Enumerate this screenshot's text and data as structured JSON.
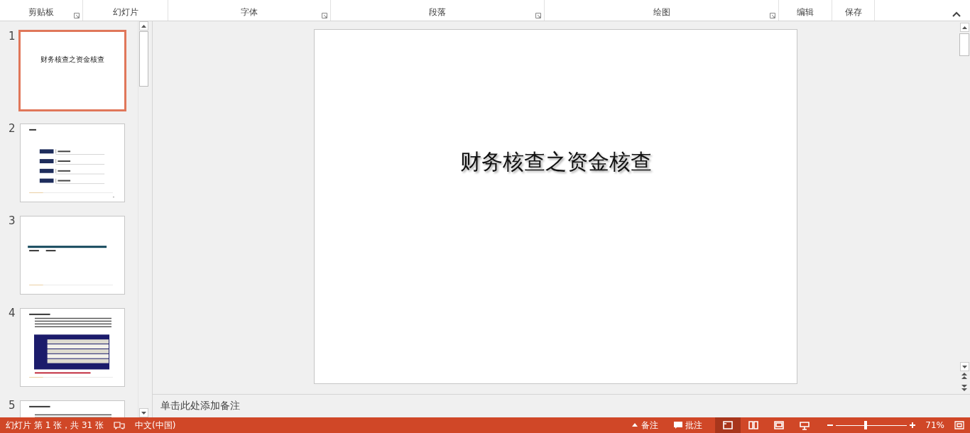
{
  "ribbon": {
    "groups": [
      {
        "label": "剪贴板",
        "launcher": true
      },
      {
        "label": "幻灯片",
        "launcher": false
      },
      {
        "label": "字体",
        "launcher": true
      },
      {
        "label": "段落",
        "launcher": true
      },
      {
        "label": "绘图",
        "launcher": true
      },
      {
        "label": "编辑",
        "launcher": false
      },
      {
        "label": "保存",
        "launcher": false
      }
    ]
  },
  "thumbnails": [
    {
      "number": "1",
      "kind": "title",
      "title": "财务核查之资金核查",
      "selected": true
    },
    {
      "number": "2",
      "kind": "toc",
      "selected": false
    },
    {
      "number": "3",
      "kind": "section",
      "selected": false
    },
    {
      "number": "4",
      "kind": "table",
      "selected": false
    },
    {
      "number": "5",
      "kind": "text",
      "selected": false
    }
  ],
  "slide": {
    "title": "财务核查之资金核查"
  },
  "notes": {
    "placeholder": "单击此处添加备注"
  },
  "status_bar": {
    "slide_info": "幻灯片 第 1 张，共 31 张",
    "language": "中文(中国)",
    "notes_button": "备注",
    "comments_button": "批注",
    "views": [
      {
        "kind": "normal",
        "selected": true
      },
      {
        "kind": "sorter",
        "selected": false
      },
      {
        "kind": "reading",
        "selected": false
      },
      {
        "kind": "show",
        "selected": false
      }
    ],
    "zoom": {
      "level": 0.42
    },
    "zoom_text": "71%"
  }
}
